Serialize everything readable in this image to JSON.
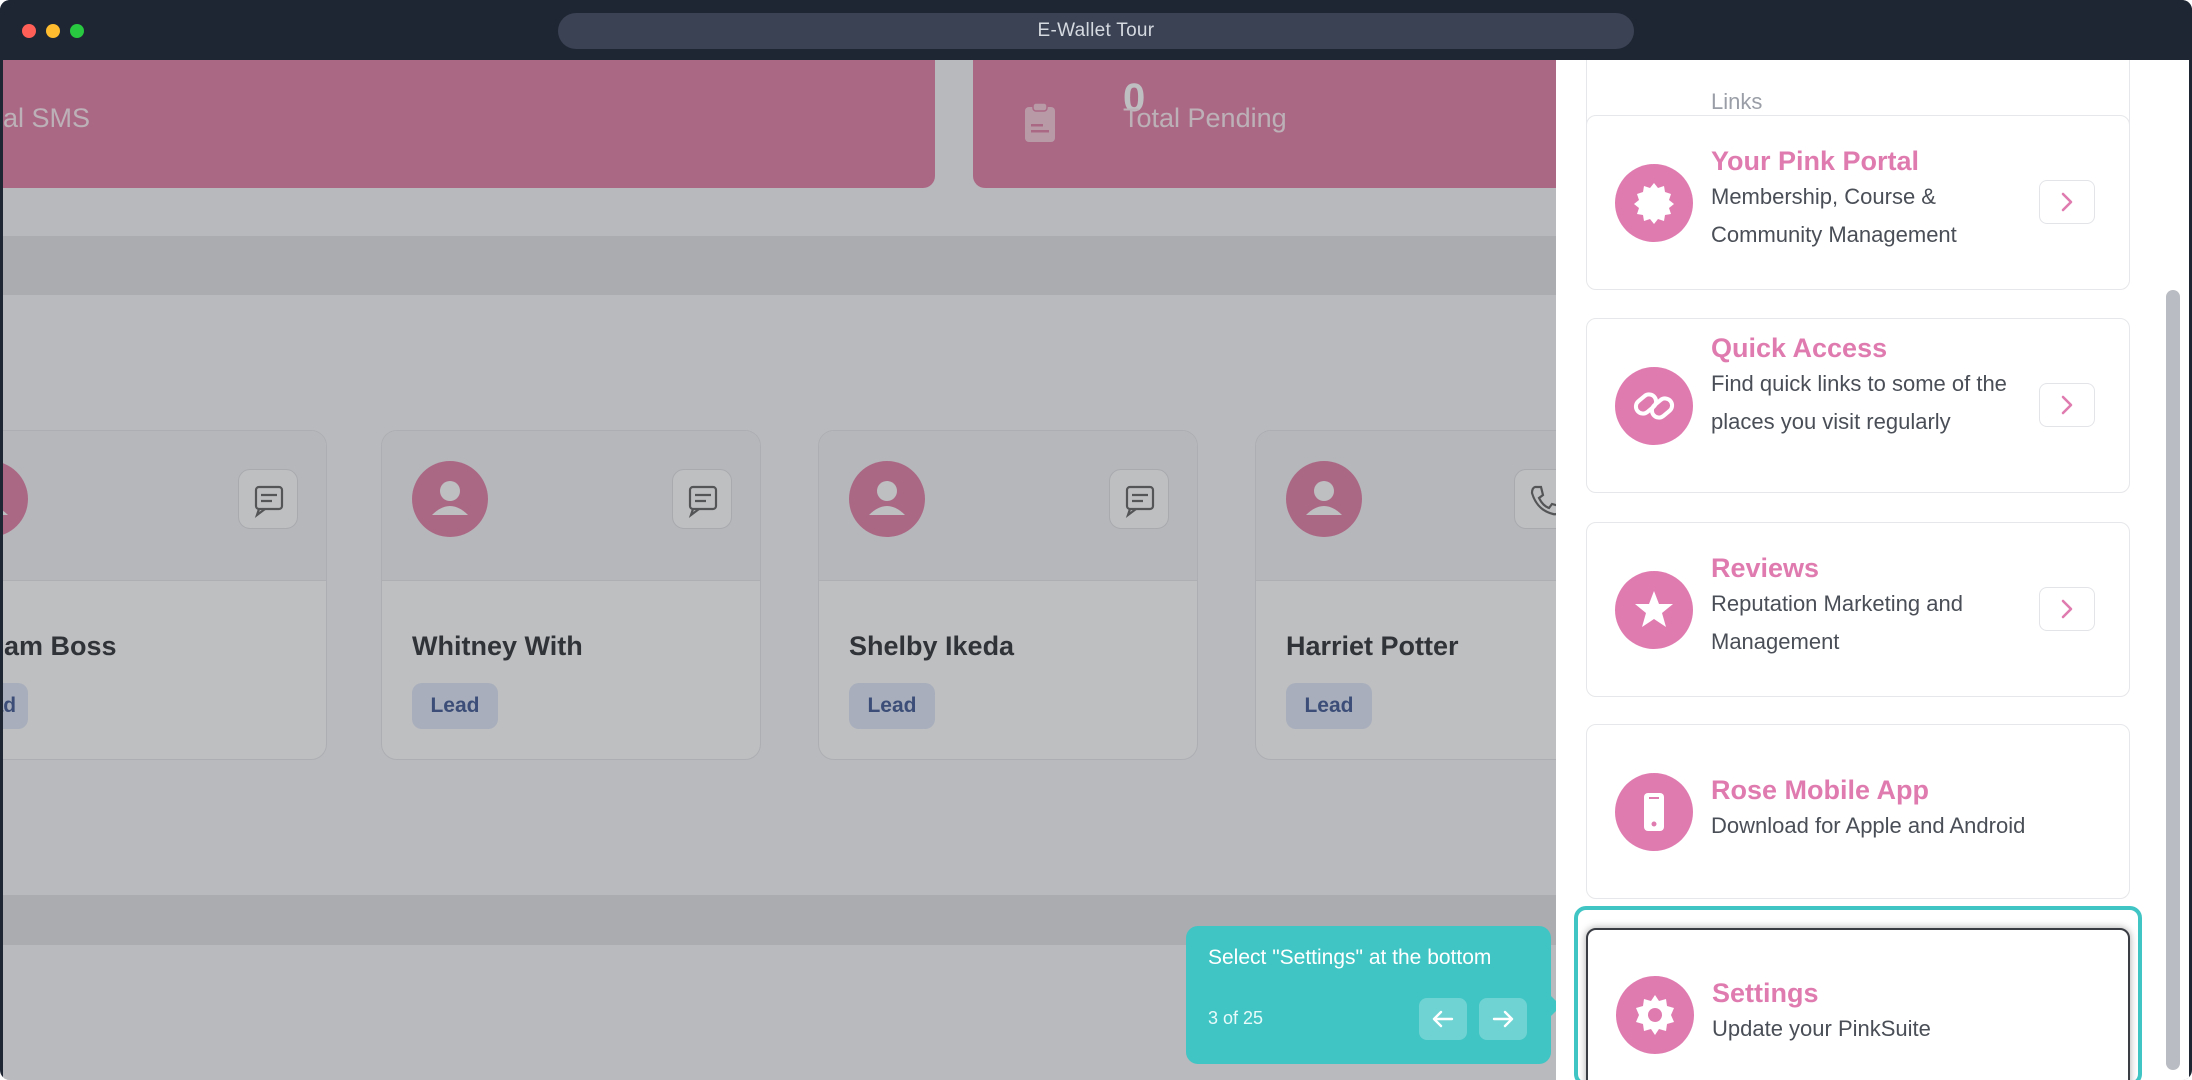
{
  "window": {
    "title": "E-Wallet Tour"
  },
  "stats": [
    {
      "label": "al SMS",
      "value": ""
    },
    {
      "label": "Total Pending",
      "value": "0"
    }
  ],
  "contacts": [
    {
      "name": "am Boss",
      "badge": "ead"
    },
    {
      "name": "Whitney With",
      "badge": "Lead"
    },
    {
      "name": "Shelby Ikeda",
      "badge": "Lead"
    },
    {
      "name": "Harriet Potter",
      "badge": "Lead"
    }
  ],
  "drawer": {
    "partial_item": "Links",
    "items": [
      {
        "title": "Your Pink Portal",
        "desc": "Membership, Course & Community Management",
        "icon": "badge-icon"
      },
      {
        "title": "Quick Access",
        "desc": "Find quick links to some of the places you visit regularly",
        "icon": "link-icon"
      },
      {
        "title": "Reviews",
        "desc": "Reputation Marketing and Management",
        "icon": "star-icon"
      },
      {
        "title": "Rose Mobile App",
        "desc": "Download for Apple and Android",
        "icon": "phone-icon"
      },
      {
        "title": "Settings",
        "desc": "Update your PinkSuite",
        "icon": "gear-icon"
      }
    ]
  },
  "tour": {
    "text": "Select \"Settings\" at the bottom",
    "step": "3 of 25"
  },
  "colors": {
    "accent_pink": "#e07bb0",
    "tour_teal": "#40c5c4",
    "titlebar": "#1f2633"
  }
}
